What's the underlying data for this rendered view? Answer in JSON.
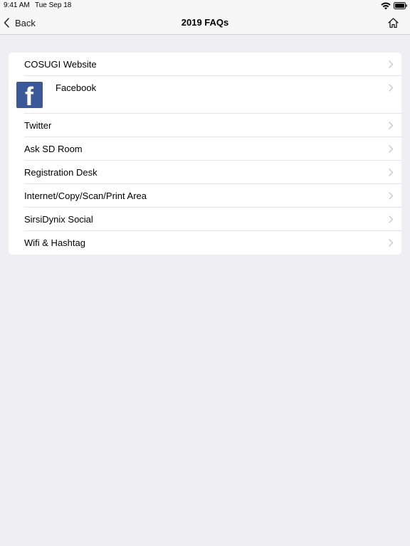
{
  "status_bar": {
    "time": "9:41 AM",
    "date": "Tue Sep 18",
    "wifi_icon": "wifi-icon",
    "battery_icon": "battery-icon"
  },
  "nav": {
    "back_label": "Back",
    "title": "2019 FAQs",
    "home_icon": "home-icon"
  },
  "list": {
    "items": [
      {
        "label": "COSUGI Website"
      },
      {
        "label": "Facebook",
        "icon": "facebook-logo"
      },
      {
        "label": "Twitter"
      },
      {
        "label": "Ask SD Room"
      },
      {
        "label": "Registration Desk"
      },
      {
        "label": "Internet/Copy/Scan/Print Area"
      },
      {
        "label": "SirsiDynix Social"
      },
      {
        "label": "Wifi & Hashtag"
      }
    ]
  },
  "colors": {
    "background": "#efeef3",
    "bar": "#f7f7f7",
    "facebook_blue": "#3b5998",
    "chevron": "#c7c7cc"
  }
}
